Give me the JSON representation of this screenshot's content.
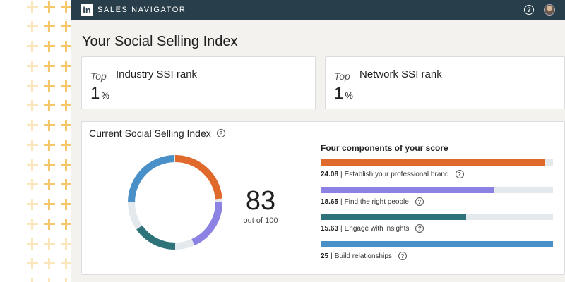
{
  "brand": {
    "logo_text": "in",
    "name": "SALES NAVIGATOR"
  },
  "nav": {
    "help_icon": "question-circle-icon",
    "avatar": "user-avatar"
  },
  "page_title": "Your Social Selling Index",
  "rank_cards": [
    {
      "prefix": "Top",
      "label": "Industry SSI rank",
      "value": "1",
      "unit": "%"
    },
    {
      "prefix": "Top",
      "label": "Network SSI rank",
      "value": "1",
      "unit": "%"
    }
  ],
  "ssi": {
    "title": "Current Social Selling Index",
    "score": "83",
    "score_sub": "out of 100",
    "components_title": "Four components of your score",
    "components": [
      {
        "value": "24.08",
        "label": "Establish your professional brand",
        "max": 25,
        "color": "#e06a2b"
      },
      {
        "value": "18.65",
        "label": "Find the right people",
        "max": 25,
        "color": "#8c82e3"
      },
      {
        "value": "15.63",
        "label": "Engage with insights",
        "max": 25,
        "color": "#2e7379"
      },
      {
        "value": "25",
        "label": "Build relationships",
        "max": 25,
        "color": "#4a90c8"
      }
    ],
    "track_color": "#e3e9ed"
  }
}
